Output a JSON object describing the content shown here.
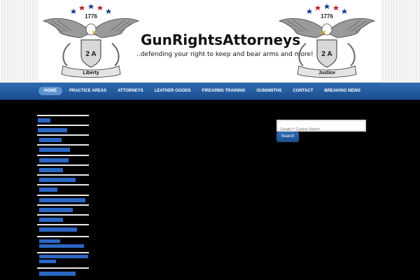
{
  "header": {
    "site_title": "GunRightsAttorneys",
    "tagline": "..defending your right to keep and bear arms and more!",
    "emblem_left": {
      "year": "1776",
      "shield": "2 A",
      "scroll": "Liberty"
    },
    "emblem_right": {
      "year": "1776",
      "shield": "2 A",
      "scroll": "Justice"
    }
  },
  "nav": {
    "items": [
      {
        "label": "HOME",
        "active": true
      },
      {
        "label": "PRACTICE AREAS"
      },
      {
        "label": "ATTORNEYS"
      },
      {
        "label": "LEATHER GOODS"
      },
      {
        "label": "FIREARMS TRAINING"
      },
      {
        "label": "GUNSMITHS"
      },
      {
        "label": "CONTACT"
      },
      {
        "label": "BREAKING NEWS"
      }
    ]
  },
  "search": {
    "placeholder": "Google™ Custom Search",
    "button_label": "Search"
  },
  "colors": {
    "nav_blue": "#1b4f8f",
    "link_blue": "#2b66c4",
    "background": "#000000"
  }
}
